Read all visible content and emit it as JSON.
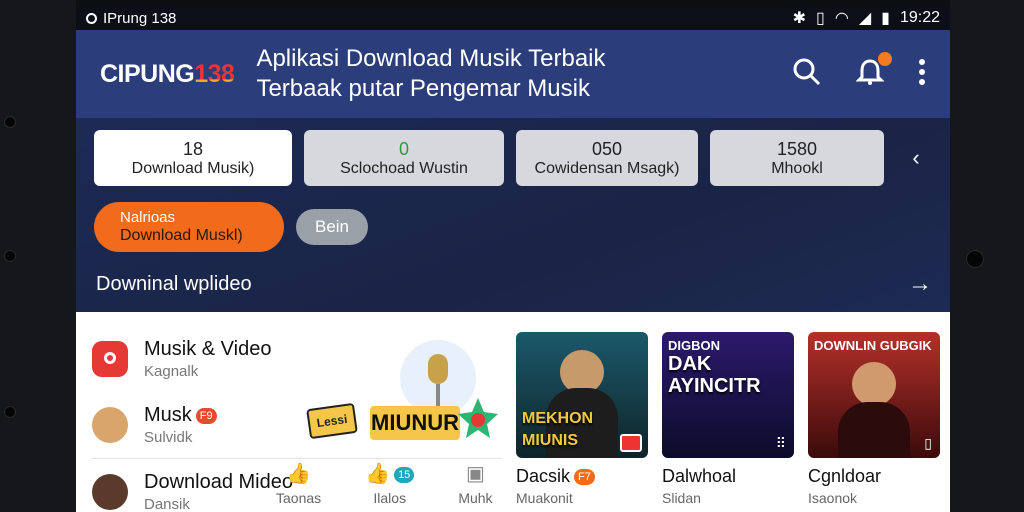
{
  "status": {
    "carrier": "IPrung 138",
    "time": "19:22"
  },
  "header": {
    "brand_prefix": "CIPUNG",
    "brand_num": "138",
    "tagline_1": "Aplikasi Download Musik Terbaik",
    "tagline_2": "Terbaak putar Pengemar Musik"
  },
  "stats": [
    {
      "value": "18",
      "label": "Download Musik)"
    },
    {
      "value": "0",
      "label": "Sclochoad Wustin"
    },
    {
      "value": "050",
      "label": "Cowidensan Msagk)"
    },
    {
      "value": "1580",
      "label": "Mhookl"
    }
  ],
  "buttons": {
    "primary_top": "Nalrioas",
    "primary_main": "Download Muskl)",
    "secondary": "Bein"
  },
  "download_row": {
    "label": "Downinal wplideo"
  },
  "list": [
    {
      "title": "Musik & Video",
      "subtitle": "Kagnalk"
    },
    {
      "title": "Musk",
      "badge": "F9",
      "subtitle": "Sulvidk"
    },
    {
      "title": "Download Mideo",
      "subtitle": "Dansik"
    }
  ],
  "art_logos": {
    "logo_1": "Lessi",
    "logo_2": "MIUNUR"
  },
  "tabs": [
    {
      "label": "Taonas"
    },
    {
      "label": "Ilalos",
      "badge": "15"
    },
    {
      "label": "Muhk"
    }
  ],
  "cards": [
    {
      "art_title": "MEKHON MIUNIS",
      "title": "Dacsik",
      "badge": "F7",
      "subtitle": "Muakonit",
      "color_top": "#1b5a6a",
      "color_bottom": "#0f2329"
    },
    {
      "art_title_top": "DIGBON",
      "art_title": "DAK AYINCITR",
      "title": "Dalwhoal",
      "subtitle": "Slidan",
      "color_top": "#2b1a6b",
      "color_bottom": "#0d0b2a"
    },
    {
      "art_title_top": "DOWNLIN GUBGIK",
      "art_title": "",
      "title": "Cgnldoar",
      "subtitle": "Isaonok",
      "color_top": "#b5302a",
      "color_bottom": "#3b0b0b"
    }
  ],
  "colors": {
    "header_bg": "#2b3d7a",
    "accent_orange": "#f26a1b",
    "brand_red": "#e33333"
  }
}
